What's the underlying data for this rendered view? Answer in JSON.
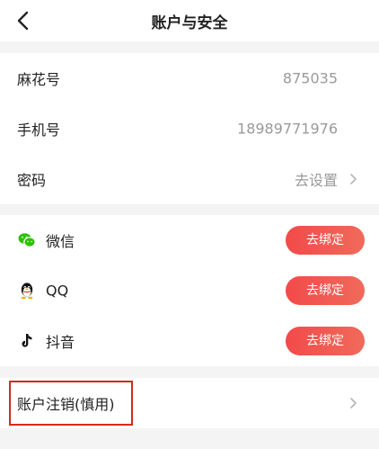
{
  "header": {
    "title": "账户与安全"
  },
  "account": {
    "mahua_label": "麻花号",
    "mahua_value": "875035",
    "phone_label": "手机号",
    "phone_value": "18989771976",
    "password_label": "密码",
    "password_value": "去设置"
  },
  "social": [
    {
      "label": "微信",
      "button": "去绑定",
      "icon": "wechat-icon"
    },
    {
      "label": "QQ",
      "button": "去绑定",
      "icon": "qq-icon"
    },
    {
      "label": "抖音",
      "button": "去绑定",
      "icon": "douyin-icon"
    }
  ],
  "danger": {
    "cancel_label": "账户注销(慎用)"
  },
  "colors": {
    "accent": "#f24a4a",
    "wechat": "#2dc100",
    "highlight": "#d6281e",
    "muted": "#9a9a9a"
  }
}
